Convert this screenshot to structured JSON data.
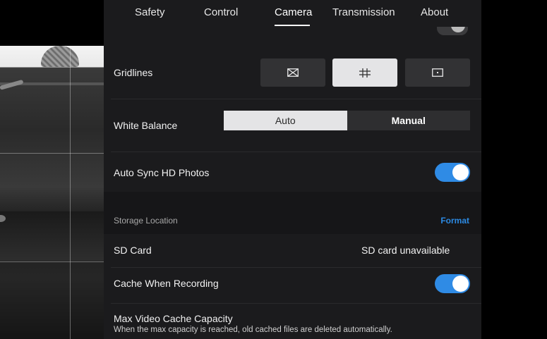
{
  "tabs": [
    {
      "label": "Safety"
    },
    {
      "label": "Control"
    },
    {
      "label": "Camera"
    },
    {
      "label": "Transmission"
    },
    {
      "label": "About"
    }
  ],
  "active_tab": "Camera",
  "gridlines": {
    "label": "Gridlines",
    "options": [
      {
        "icon": "grid-diagonal-icon"
      },
      {
        "icon": "grid-thirds-icon"
      },
      {
        "icon": "grid-center-point-icon"
      }
    ],
    "selected_index": 1
  },
  "white_balance": {
    "label": "White Balance",
    "options": [
      "Auto",
      "Manual"
    ],
    "selected": "Auto"
  },
  "auto_sync": {
    "label": "Auto Sync HD Photos",
    "enabled": true
  },
  "storage": {
    "header": "Storage Location",
    "format_link": "Format"
  },
  "sd_card": {
    "label": "SD Card",
    "status": "SD card unavailable"
  },
  "cache_recording": {
    "label": "Cache When Recording",
    "enabled": true
  },
  "max_cache": {
    "label": "Max Video Cache Capacity",
    "description": "When the max capacity is reached, old cached files are deleted automatically."
  },
  "colors": {
    "accent": "#2f8be5",
    "link": "#2c8ae3",
    "panel": "#1b1b1d"
  }
}
